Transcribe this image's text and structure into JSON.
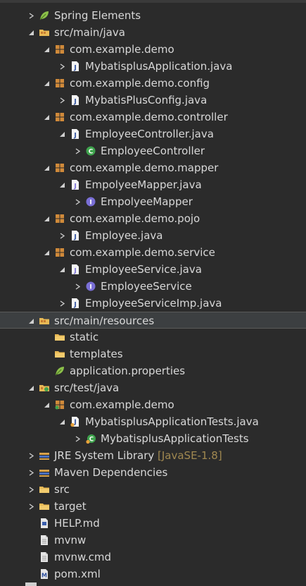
{
  "tree": [
    {
      "label": "Spring Elements",
      "depth": 0,
      "expand": "collapsed",
      "icon": "spring-leaf-icon"
    },
    {
      "label": "src/main/java",
      "depth": 0,
      "expand": "expanded",
      "icon": "source-folder-icon"
    },
    {
      "label": "com.example.demo",
      "depth": 1,
      "expand": "expanded",
      "icon": "package-icon"
    },
    {
      "label": "MybatisplusApplication.java",
      "depth": 2,
      "expand": "collapsed",
      "icon": "java-file-icon"
    },
    {
      "label": "com.example.demo.config",
      "depth": 1,
      "expand": "expanded",
      "icon": "package-icon"
    },
    {
      "label": "MybatisPlusConfig.java",
      "depth": 2,
      "expand": "collapsed",
      "icon": "java-file-icon"
    },
    {
      "label": "com.example.demo.controller",
      "depth": 1,
      "expand": "expanded",
      "icon": "package-icon"
    },
    {
      "label": "EmployeeController.java",
      "depth": 2,
      "expand": "expanded",
      "icon": "java-file-icon"
    },
    {
      "label": "EmployeeController",
      "depth": 3,
      "expand": "collapsed",
      "icon": "class-icon"
    },
    {
      "label": "com.example.demo.mapper",
      "depth": 1,
      "expand": "expanded",
      "icon": "package-icon"
    },
    {
      "label": "EmpolyeeMapper.java",
      "depth": 2,
      "expand": "expanded",
      "icon": "java-interface-file-icon"
    },
    {
      "label": "EmpolyeeMapper",
      "depth": 3,
      "expand": "collapsed",
      "icon": "interface-icon"
    },
    {
      "label": "com.example.demo.pojo",
      "depth": 1,
      "expand": "expanded",
      "icon": "package-icon"
    },
    {
      "label": "Employee.java",
      "depth": 2,
      "expand": "collapsed",
      "icon": "java-file-icon"
    },
    {
      "label": "com.example.demo.service",
      "depth": 1,
      "expand": "expanded",
      "icon": "package-icon"
    },
    {
      "label": "EmployeeService.java",
      "depth": 2,
      "expand": "expanded",
      "icon": "java-interface-file-icon"
    },
    {
      "label": "EmployeeService",
      "depth": 3,
      "expand": "collapsed",
      "icon": "interface-icon"
    },
    {
      "label": "EmployeeServiceImp.java",
      "depth": 2,
      "expand": "collapsed",
      "icon": "java-file-icon"
    },
    {
      "label": "src/main/resources",
      "depth": 0,
      "expand": "expanded",
      "icon": "source-folder-icon",
      "selected": true
    },
    {
      "label": "static",
      "depth": 1,
      "expand": "none",
      "icon": "folder-icon"
    },
    {
      "label": "templates",
      "depth": 1,
      "expand": "none",
      "icon": "folder-icon"
    },
    {
      "label": "application.properties",
      "depth": 1,
      "expand": "none",
      "icon": "spring-leaf-icon"
    },
    {
      "label": "src/test/java",
      "depth": 0,
      "expand": "expanded",
      "icon": "test-source-folder-icon"
    },
    {
      "label": "com.example.demo",
      "depth": 1,
      "expand": "expanded",
      "icon": "test-package-icon"
    },
    {
      "label": "MybatisplusApplicationTests.java",
      "depth": 2,
      "expand": "expanded",
      "icon": "test-java-file-icon"
    },
    {
      "label": "MybatisplusApplicationTests",
      "depth": 3,
      "expand": "collapsed",
      "icon": "test-class-icon"
    },
    {
      "label": "JRE System Library",
      "decorator": "[JavaSE-1.8]",
      "depth": 0,
      "expand": "collapsed",
      "icon": "library-icon"
    },
    {
      "label": "Maven Dependencies",
      "depth": 0,
      "expand": "collapsed",
      "icon": "library-icon"
    },
    {
      "label": "src",
      "depth": 0,
      "expand": "collapsed",
      "icon": "folder-icon"
    },
    {
      "label": "target",
      "depth": 0,
      "expand": "collapsed",
      "icon": "folder-icon"
    },
    {
      "label": "HELP.md",
      "depth": 0,
      "expand": "none",
      "icon": "markdown-file-icon"
    },
    {
      "label": "mvnw",
      "depth": 0,
      "expand": "none",
      "icon": "file-icon"
    },
    {
      "label": "mvnw.cmd",
      "depth": 0,
      "expand": "none",
      "icon": "file-icon"
    },
    {
      "label": "pom.xml",
      "depth": 0,
      "expand": "none",
      "icon": "maven-pom-icon"
    }
  ],
  "colors": {
    "background": "#2b2b2b",
    "text": "#d8d8d8",
    "decorator": "#a08850",
    "selection": "#3c3f41",
    "folder": "#e8b955",
    "package": "#d08a3a",
    "class": "#3fa34d",
    "interface": "#7a6fd6",
    "spring": "#8cc04a"
  }
}
